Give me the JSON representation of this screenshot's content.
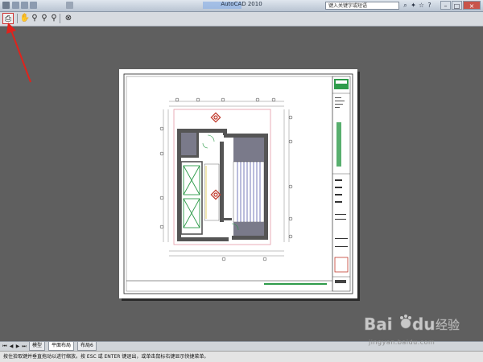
{
  "titlebar": {
    "app_title": "AutoCAD 2010",
    "search_placeholder": "键入关键字或短语"
  },
  "toolbar": {
    "tools": [
      {
        "name": "print-icon",
        "glyph": "⎙"
      },
      {
        "name": "pan-icon",
        "glyph": "✋"
      },
      {
        "name": "zoom-realtime-icon",
        "glyph": "🔍"
      },
      {
        "name": "zoom-window-icon",
        "glyph": "🔍"
      },
      {
        "name": "zoom-previous-icon",
        "glyph": "🔍"
      },
      {
        "name": "close-preview-icon",
        "glyph": "⊗"
      }
    ]
  },
  "layout_tabs": {
    "tabs": [
      "模型",
      "平面布局",
      "布局6"
    ],
    "active": "平面布局"
  },
  "status": {
    "message": "按住拾取键并垂直拖动以进行缩放。按 ESC 或 ENTER 键退出，或单击鼠标右键显示快捷菜单。"
  },
  "watermark": {
    "brand_cn": "经验",
    "url": "jingyan.baidu.com"
  },
  "colors": {
    "canvas": "#5f5f5f",
    "paper": "#ffffff",
    "annotation_arrow": "#e0231c",
    "title_block_accent": "#1f8a3a",
    "wall_hatch": "#5a4a8a",
    "fixture_red": "#c0392b"
  }
}
